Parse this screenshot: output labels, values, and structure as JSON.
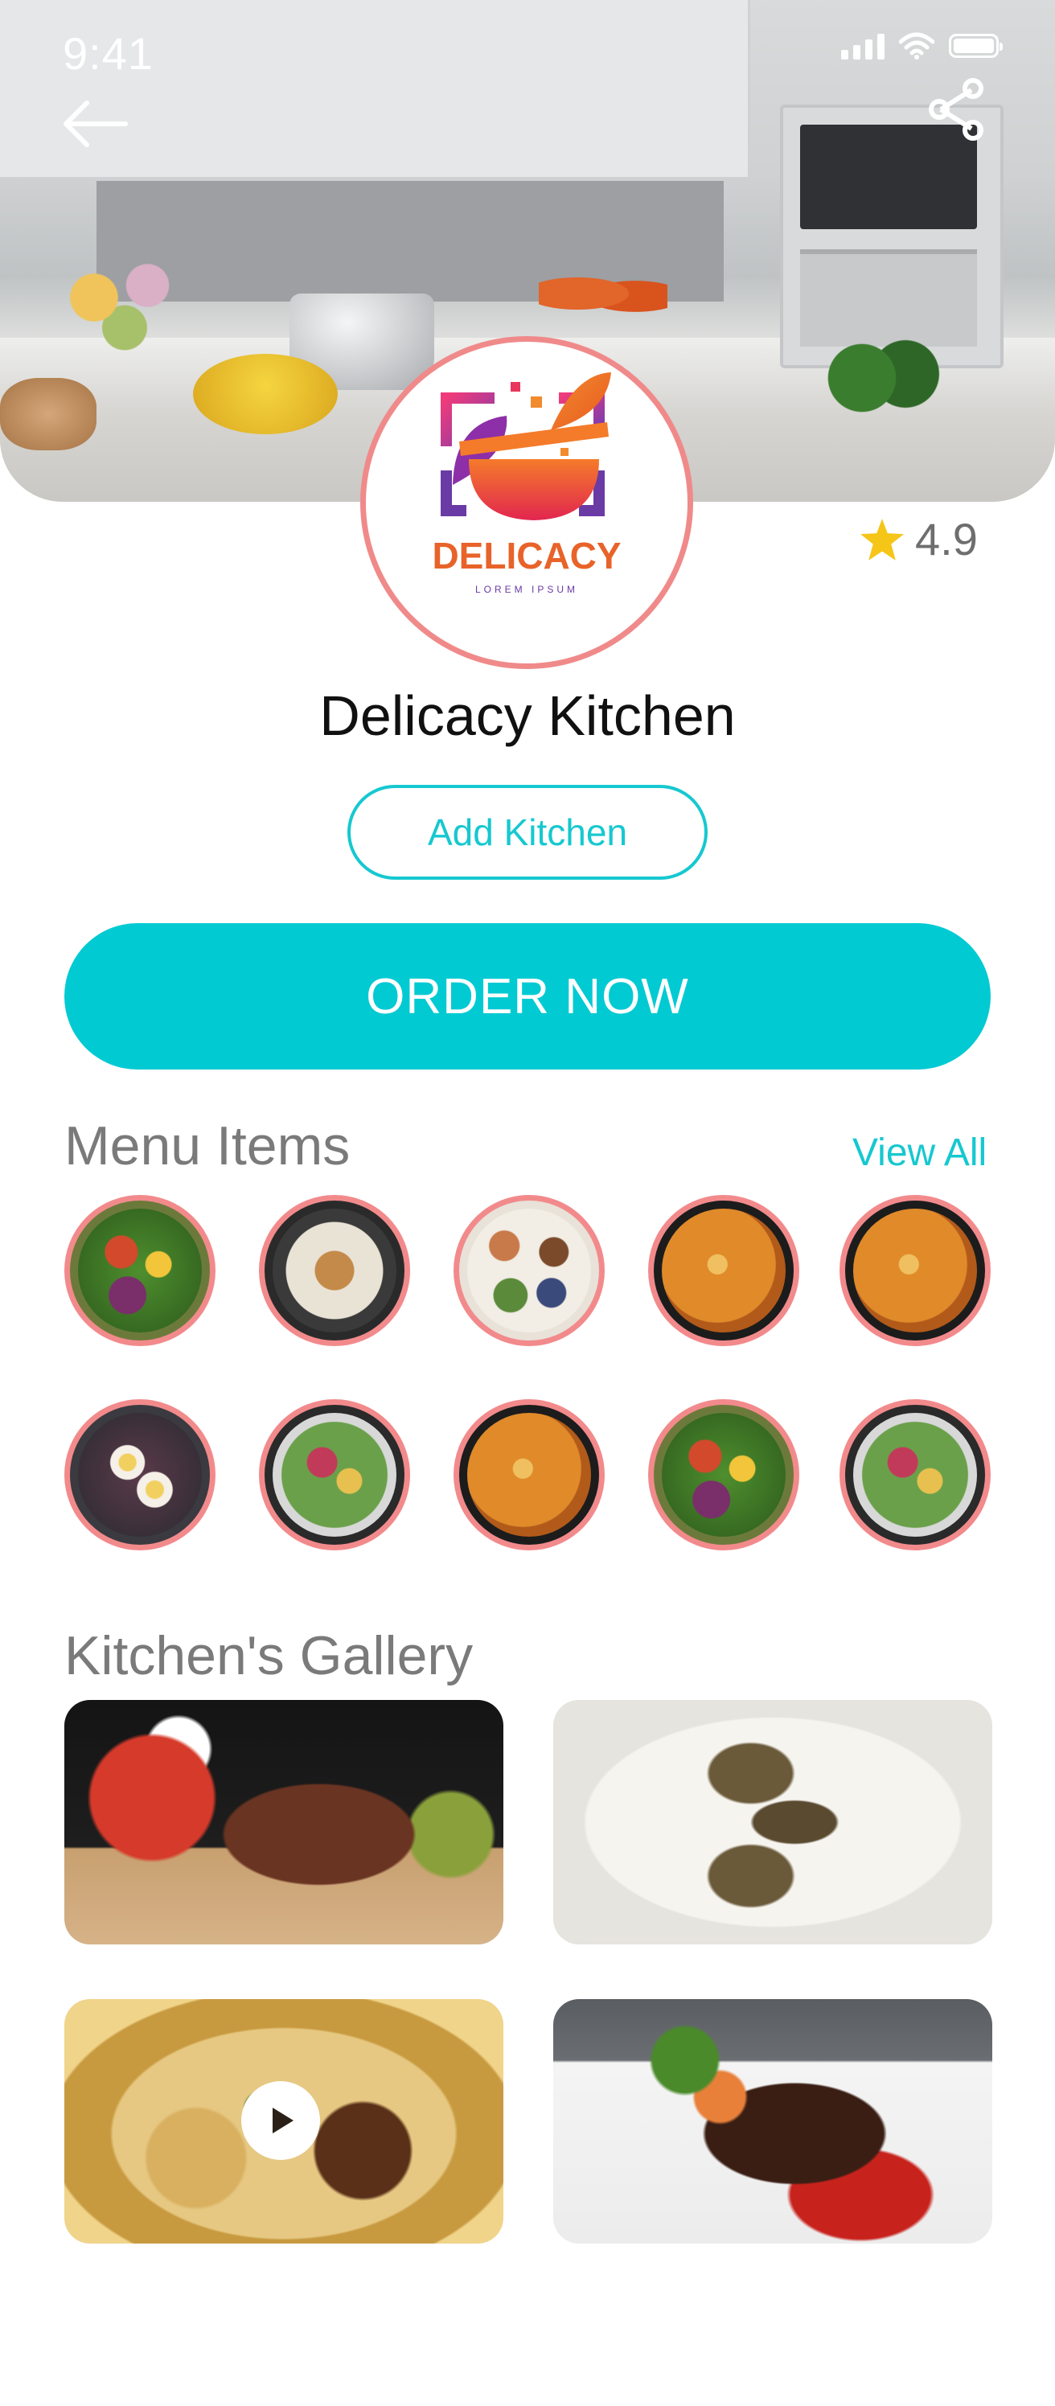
{
  "status_bar": {
    "time": "9:41"
  },
  "logo": {
    "brand": "DELICACY",
    "tagline": "LOREM IPSUM"
  },
  "rating": {
    "value": "4.9"
  },
  "kitchen": {
    "name": "Delicacy Kitchen"
  },
  "buttons": {
    "add_kitchen": "Add Kitchen",
    "order_now": "ORDER NOW"
  },
  "menu": {
    "title": "Menu Items",
    "view_all": "View All",
    "items": [
      {
        "name": "salad-bowl"
      },
      {
        "name": "grilled-fish-plate"
      },
      {
        "name": "table-spread"
      },
      {
        "name": "salmon-curry"
      },
      {
        "name": "salmon-curry"
      },
      {
        "name": "eggs-platter"
      },
      {
        "name": "poke-bowl"
      },
      {
        "name": "salmon-curry"
      },
      {
        "name": "salad-bowl"
      },
      {
        "name": "poke-bowl"
      }
    ]
  },
  "gallery": {
    "title": "Kitchen's Gallery",
    "items": [
      {
        "name": "ribs-platter"
      },
      {
        "name": "grilled-sardines"
      },
      {
        "name": "soup-video"
      },
      {
        "name": "grilled-steak"
      }
    ]
  },
  "colors": {
    "accent": "#02cad3",
    "ring": "#f28a8c",
    "star": "#f5c518"
  }
}
